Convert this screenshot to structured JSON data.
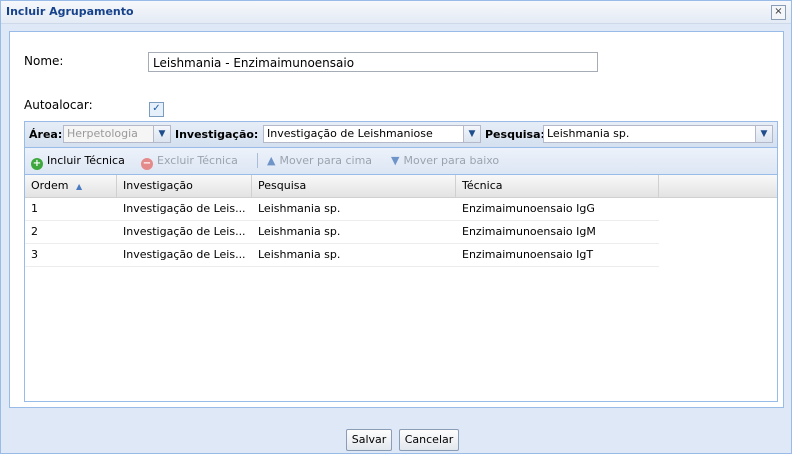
{
  "window": {
    "title": "Incluir Agrupamento",
    "close_glyph": "×"
  },
  "form": {
    "nome_label": "Nome:",
    "nome_value": "Leishmania - Enzimaimunoensaio",
    "autoalocar_label": "Autoalocar:",
    "autoalocar_checked": true
  },
  "filter": {
    "area_label": "Área:",
    "area_value": "Herpetologia",
    "investigacao_label": "Investigação:",
    "investigacao_value": "Investigação de Leishmaniose",
    "pesquisa_label": "Pesquisa:",
    "pesquisa_value": "Leishmania sp."
  },
  "toolbar": {
    "incluir": "Incluir Técnica",
    "excluir": "Excluir Técnica",
    "mover_cima": "Mover para cima",
    "mover_baixo": "Mover para baixo"
  },
  "table": {
    "columns": [
      "Ordem",
      "Investigação",
      "Pesquisa",
      "Técnica"
    ],
    "rows": [
      [
        "1",
        "Investigação de Leis...",
        "Leishmania sp.",
        "Enzimaimunoensaio IgG"
      ],
      [
        "2",
        "Investigação de Leis...",
        "Leishmania sp.",
        "Enzimaimunoensaio IgM"
      ],
      [
        "3",
        "Investigação de Leis...",
        "Leishmania sp.",
        "Enzimaimunoensaio IgT"
      ]
    ]
  },
  "buttons": {
    "salvar": "Salvar",
    "cancelar": "Cancelar"
  },
  "icons": {
    "add": "add-icon",
    "remove": "remove-icon",
    "up": "arrow-up-icon",
    "down": "arrow-down-icon",
    "sort": "sort-ascending-icon",
    "combo": "chevron-down-icon"
  },
  "colors": {
    "accent": "#15428b",
    "border": "#99bbe8",
    "add_green": "#3ea83e",
    "remove_red": "#e05757"
  }
}
